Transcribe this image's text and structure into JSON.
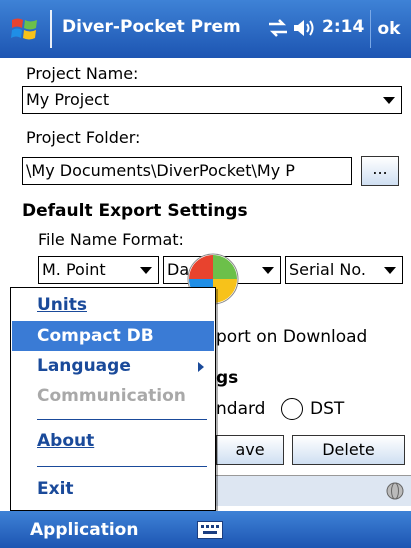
{
  "titlebar": {
    "title": "Diver-Pocket Prem",
    "time": "2:14",
    "ok_label": "ok",
    "icons": [
      "windows-start-icon",
      "connectivity-icon",
      "speaker-icon"
    ]
  },
  "form": {
    "project_name_label": "Project Name:",
    "project_name_value": "My Project",
    "project_folder_label": "Project Folder:",
    "project_folder_value": "\\My Documents\\DiverPocket\\My P",
    "browse_label": "...",
    "default_export_heading": "Default Export Settings",
    "file_name_format_label": "File Name Format:",
    "format_select_1": "M. Point",
    "format_select_2": "Da",
    "format_select_3": "Serial No.",
    "export_on_download_label": "port on Download",
    "settings_heading_partial": "gs",
    "standard_radio_label": "ndard",
    "dst_radio_label": "DST",
    "save_button_partial": "ave",
    "delete_button_label": "Delete"
  },
  "menu": {
    "items": [
      {
        "label": "Units",
        "state": "normal"
      },
      {
        "label": "Compact DB",
        "state": "highlighted"
      },
      {
        "label": "Language",
        "state": "normal",
        "submenu": true
      },
      {
        "label": "Communication",
        "state": "disabled"
      },
      {
        "label": "About",
        "state": "normal"
      },
      {
        "label": "Exit",
        "state": "normal"
      }
    ]
  },
  "bottombar": {
    "application_label": "Application",
    "keyboard_icon": "keyboard-icon"
  },
  "colors": {
    "titlebar": "#2a66c4",
    "menu_highlight": "#3a7bd5",
    "menu_text": "#1a4a9a",
    "disabled_text": "#a9a9a9"
  }
}
